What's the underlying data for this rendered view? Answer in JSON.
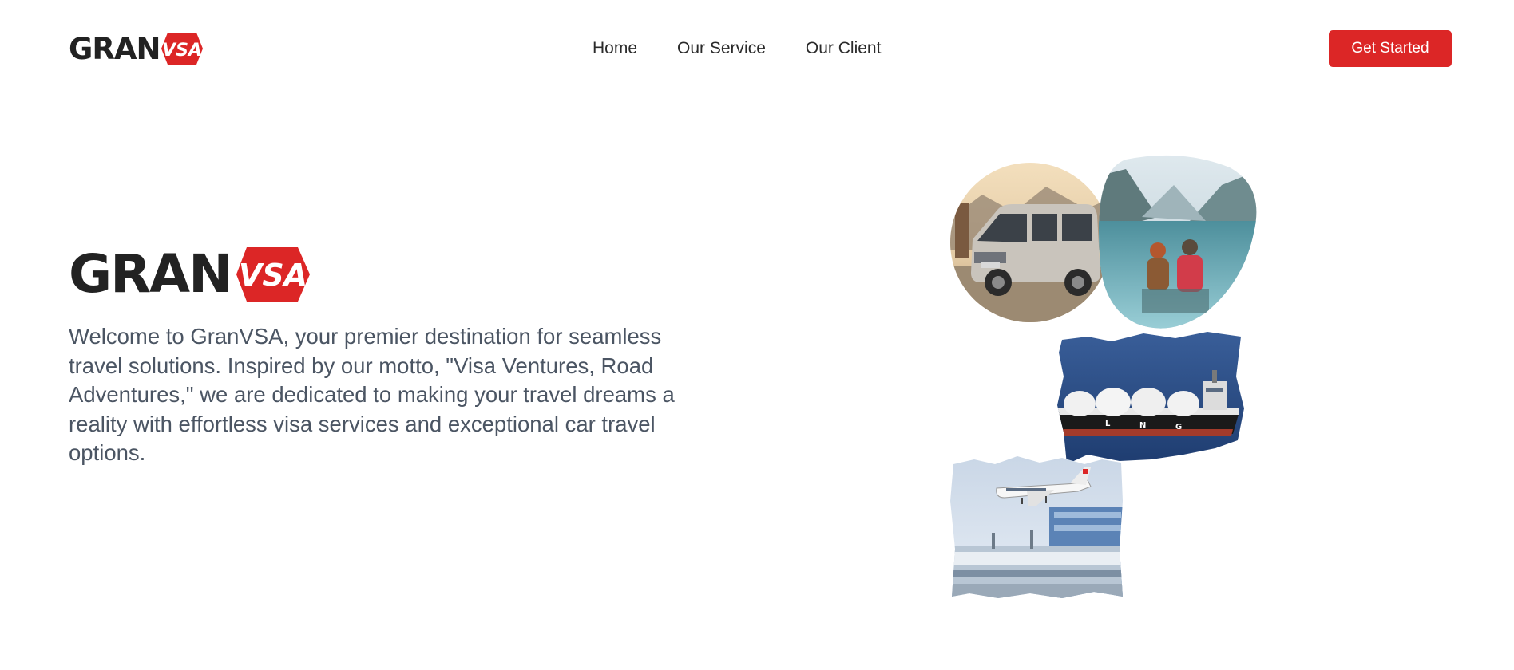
{
  "brand": {
    "word": "GRAN",
    "badge": "VSA",
    "colors": {
      "wordmark": "#222222",
      "accent": "#dc2626"
    }
  },
  "nav": {
    "items": [
      {
        "label": "Home"
      },
      {
        "label": "Our Service"
      },
      {
        "label": "Our Client"
      }
    ]
  },
  "cta": {
    "label": "Get Started"
  },
  "hero": {
    "intro": "Welcome to GranVSA, your premier destination for seamless travel solutions. Inspired by our motto, \"Visa Ventures, Road Adventures,\" we are dedicated to making your travel dreams a reality with effortless visa services and exceptional car travel options.",
    "ship_hull_letters": [
      "L",
      "N",
      "G"
    ]
  },
  "collage": {
    "images": [
      {
        "icon": "van-photo"
      },
      {
        "icon": "lake-travelers-photo"
      },
      {
        "icon": "lng-ship-photo"
      },
      {
        "icon": "airport-jet-photo"
      }
    ]
  }
}
